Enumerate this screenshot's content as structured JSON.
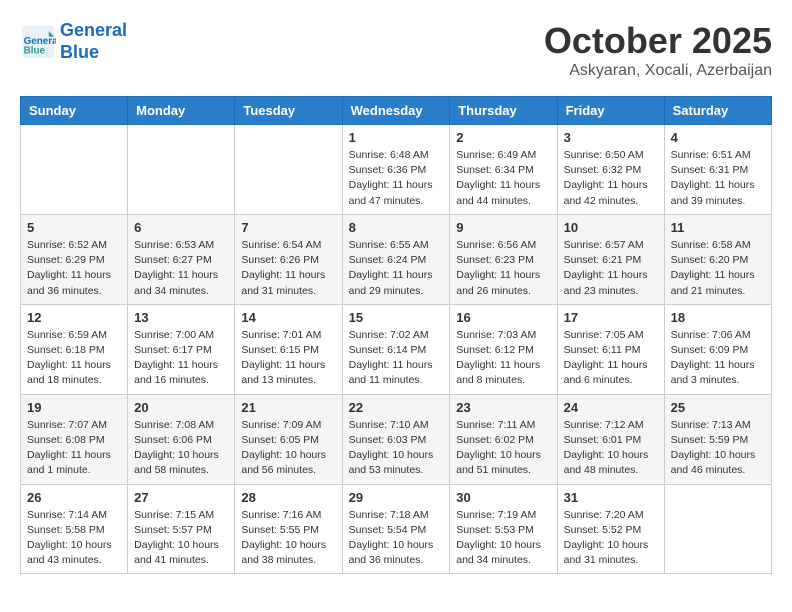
{
  "header": {
    "logo_line1": "General",
    "logo_line2": "Blue",
    "month": "October 2025",
    "location": "Askyaran, Xocali, Azerbaijan"
  },
  "days_of_week": [
    "Sunday",
    "Monday",
    "Tuesday",
    "Wednesday",
    "Thursday",
    "Friday",
    "Saturday"
  ],
  "weeks": [
    [
      {
        "day": "",
        "info": ""
      },
      {
        "day": "",
        "info": ""
      },
      {
        "day": "",
        "info": ""
      },
      {
        "day": "1",
        "info": "Sunrise: 6:48 AM\nSunset: 6:36 PM\nDaylight: 11 hours\nand 47 minutes."
      },
      {
        "day": "2",
        "info": "Sunrise: 6:49 AM\nSunset: 6:34 PM\nDaylight: 11 hours\nand 44 minutes."
      },
      {
        "day": "3",
        "info": "Sunrise: 6:50 AM\nSunset: 6:32 PM\nDaylight: 11 hours\nand 42 minutes."
      },
      {
        "day": "4",
        "info": "Sunrise: 6:51 AM\nSunset: 6:31 PM\nDaylight: 11 hours\nand 39 minutes."
      }
    ],
    [
      {
        "day": "5",
        "info": "Sunrise: 6:52 AM\nSunset: 6:29 PM\nDaylight: 11 hours\nand 36 minutes."
      },
      {
        "day": "6",
        "info": "Sunrise: 6:53 AM\nSunset: 6:27 PM\nDaylight: 11 hours\nand 34 minutes."
      },
      {
        "day": "7",
        "info": "Sunrise: 6:54 AM\nSunset: 6:26 PM\nDaylight: 11 hours\nand 31 minutes."
      },
      {
        "day": "8",
        "info": "Sunrise: 6:55 AM\nSunset: 6:24 PM\nDaylight: 11 hours\nand 29 minutes."
      },
      {
        "day": "9",
        "info": "Sunrise: 6:56 AM\nSunset: 6:23 PM\nDaylight: 11 hours\nand 26 minutes."
      },
      {
        "day": "10",
        "info": "Sunrise: 6:57 AM\nSunset: 6:21 PM\nDaylight: 11 hours\nand 23 minutes."
      },
      {
        "day": "11",
        "info": "Sunrise: 6:58 AM\nSunset: 6:20 PM\nDaylight: 11 hours\nand 21 minutes."
      }
    ],
    [
      {
        "day": "12",
        "info": "Sunrise: 6:59 AM\nSunset: 6:18 PM\nDaylight: 11 hours\nand 18 minutes."
      },
      {
        "day": "13",
        "info": "Sunrise: 7:00 AM\nSunset: 6:17 PM\nDaylight: 11 hours\nand 16 minutes."
      },
      {
        "day": "14",
        "info": "Sunrise: 7:01 AM\nSunset: 6:15 PM\nDaylight: 11 hours\nand 13 minutes."
      },
      {
        "day": "15",
        "info": "Sunrise: 7:02 AM\nSunset: 6:14 PM\nDaylight: 11 hours\nand 11 minutes."
      },
      {
        "day": "16",
        "info": "Sunrise: 7:03 AM\nSunset: 6:12 PM\nDaylight: 11 hours\nand 8 minutes."
      },
      {
        "day": "17",
        "info": "Sunrise: 7:05 AM\nSunset: 6:11 PM\nDaylight: 11 hours\nand 6 minutes."
      },
      {
        "day": "18",
        "info": "Sunrise: 7:06 AM\nSunset: 6:09 PM\nDaylight: 11 hours\nand 3 minutes."
      }
    ],
    [
      {
        "day": "19",
        "info": "Sunrise: 7:07 AM\nSunset: 6:08 PM\nDaylight: 11 hours\nand 1 minute."
      },
      {
        "day": "20",
        "info": "Sunrise: 7:08 AM\nSunset: 6:06 PM\nDaylight: 10 hours\nand 58 minutes."
      },
      {
        "day": "21",
        "info": "Sunrise: 7:09 AM\nSunset: 6:05 PM\nDaylight: 10 hours\nand 56 minutes."
      },
      {
        "day": "22",
        "info": "Sunrise: 7:10 AM\nSunset: 6:03 PM\nDaylight: 10 hours\nand 53 minutes."
      },
      {
        "day": "23",
        "info": "Sunrise: 7:11 AM\nSunset: 6:02 PM\nDaylight: 10 hours\nand 51 minutes."
      },
      {
        "day": "24",
        "info": "Sunrise: 7:12 AM\nSunset: 6:01 PM\nDaylight: 10 hours\nand 48 minutes."
      },
      {
        "day": "25",
        "info": "Sunrise: 7:13 AM\nSunset: 5:59 PM\nDaylight: 10 hours\nand 46 minutes."
      }
    ],
    [
      {
        "day": "26",
        "info": "Sunrise: 7:14 AM\nSunset: 5:58 PM\nDaylight: 10 hours\nand 43 minutes."
      },
      {
        "day": "27",
        "info": "Sunrise: 7:15 AM\nSunset: 5:57 PM\nDaylight: 10 hours\nand 41 minutes."
      },
      {
        "day": "28",
        "info": "Sunrise: 7:16 AM\nSunset: 5:55 PM\nDaylight: 10 hours\nand 38 minutes."
      },
      {
        "day": "29",
        "info": "Sunrise: 7:18 AM\nSunset: 5:54 PM\nDaylight: 10 hours\nand 36 minutes."
      },
      {
        "day": "30",
        "info": "Sunrise: 7:19 AM\nSunset: 5:53 PM\nDaylight: 10 hours\nand 34 minutes."
      },
      {
        "day": "31",
        "info": "Sunrise: 7:20 AM\nSunset: 5:52 PM\nDaylight: 10 hours\nand 31 minutes."
      },
      {
        "day": "",
        "info": ""
      }
    ]
  ]
}
